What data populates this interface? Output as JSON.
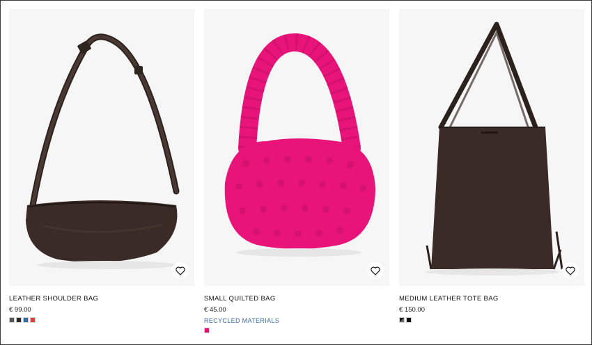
{
  "products": [
    {
      "name": "LEATHER SHOULDER BAG",
      "price": "€ 99.00",
      "tag": "",
      "image_icon": "leather-shoulder-bag-image",
      "swatches": [
        "#5b5450",
        "#2a2a2a",
        "#2f6ea6",
        "#d8413f"
      ]
    },
    {
      "name": "SMALL QUILTED BAG",
      "price": "€ 45.00",
      "tag": "RECYCLED MATERIALS",
      "image_icon": "quilted-bag-image",
      "swatches": [
        "#e1136f"
      ]
    },
    {
      "name": "MEDIUM LEATHER TOTE BAG",
      "price": "€ 150.00",
      "tag": "",
      "image_icon": "leather-tote-bag-image",
      "swatches": [
        "split-black-grey",
        "#111111"
      ]
    }
  ],
  "colors": {
    "tag_blue": "#3d6a9c",
    "image_background": "#f6f6f6",
    "leather_brown": "#3a2b26",
    "quilted_pink": "#e8147a"
  },
  "wishlist_icon": "heart-outline-icon"
}
